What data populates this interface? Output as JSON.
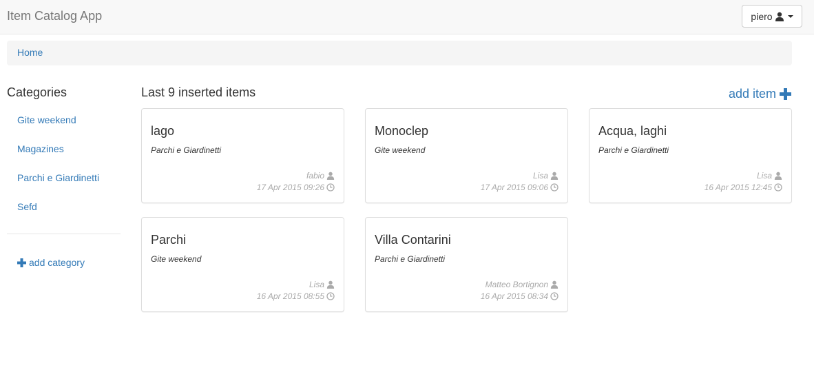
{
  "navbar": {
    "brand": "Item Catalog App",
    "user_name": "piero"
  },
  "breadcrumb": {
    "home": "Home"
  },
  "sidebar": {
    "title": "Categories",
    "items": [
      {
        "label": "Gite weekend"
      },
      {
        "label": "Magazines"
      },
      {
        "label": "Parchi e Giardinetti"
      },
      {
        "label": "Sefd"
      }
    ],
    "add_label": "add category"
  },
  "main": {
    "title": "Last 9 inserted items",
    "add_label": "add item",
    "items": [
      {
        "title": "lago",
        "category": "Parchi e Giardinetti",
        "user": "fabio",
        "date": "17 Apr 2015 09:26"
      },
      {
        "title": "Monoclep",
        "category": "Gite weekend",
        "user": "Lisa",
        "date": "17 Apr 2015 09:06"
      },
      {
        "title": "Acqua, laghi",
        "category": "Parchi e Giardinetti",
        "user": "Lisa",
        "date": "16 Apr 2015 12:45"
      },
      {
        "title": "Parchi",
        "category": "Gite weekend",
        "user": "Lisa",
        "date": "16 Apr 2015 08:55"
      },
      {
        "title": "Villa Contarini",
        "category": "Parchi e Giardinetti",
        "user": "Matteo Bortignon",
        "date": "16 Apr 2015 08:34"
      }
    ]
  },
  "colors": {
    "link": "#337ab7",
    "muted": "#aaaaaa",
    "navbar_bg": "#f8f8f8"
  },
  "icons": {
    "user": "user-icon",
    "clock": "clock-icon",
    "plus": "plus-icon",
    "caret": "caret-down-icon"
  }
}
